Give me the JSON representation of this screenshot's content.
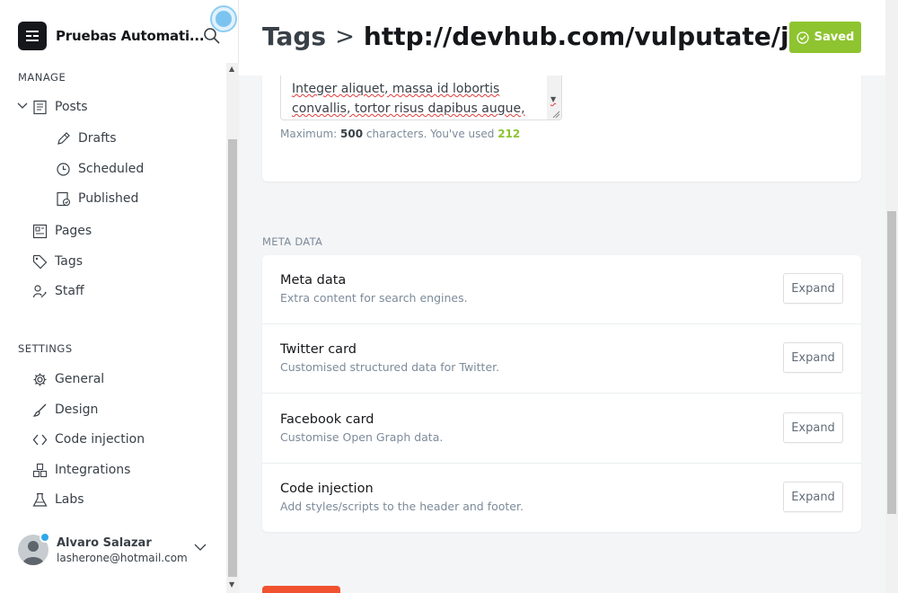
{
  "sidebar": {
    "brand": "Pruebas Automati...",
    "manage_title": "MANAGE",
    "settings_title": "SETTINGS",
    "manage_items": [
      {
        "label": "Posts",
        "icon": "posts-icon"
      },
      {
        "label": "Drafts",
        "icon": "pencil-icon"
      },
      {
        "label": "Scheduled",
        "icon": "clock-icon"
      },
      {
        "label": "Published",
        "icon": "published-icon"
      },
      {
        "label": "Pages",
        "icon": "pages-icon"
      },
      {
        "label": "Tags",
        "icon": "tag-icon"
      },
      {
        "label": "Staff",
        "icon": "staff-icon"
      }
    ],
    "settings_items": [
      {
        "label": "General",
        "icon": "gear-icon"
      },
      {
        "label": "Design",
        "icon": "brush-icon"
      },
      {
        "label": "Code injection",
        "icon": "code-icon"
      },
      {
        "label": "Integrations",
        "icon": "integrations-icon"
      },
      {
        "label": "Labs",
        "icon": "flask-icon"
      }
    ],
    "user": {
      "name": "Alvaro Salazar",
      "email": "lasherone@hotmail.com"
    }
  },
  "header": {
    "crumb_parent": "Tags",
    "crumb_separator": ">",
    "crumb_url": "http://devhub.com/vulputate/justo/in/",
    "saved_label": "Saved"
  },
  "description": {
    "text_line1": "Integer aliquet, massa id lobortis",
    "text_line2": "convallis, tortor risus dapibus augue, vel",
    "hint_prefix": "Maximum:",
    "hint_max": "500",
    "hint_mid": "characters. You've used",
    "hint_used": "212"
  },
  "meta": {
    "section_title": "META DATA",
    "rows": [
      {
        "title": "Meta data",
        "desc": "Extra content for search engines.",
        "button": "Expand"
      },
      {
        "title": "Twitter card",
        "desc": "Customised structured data for Twitter.",
        "button": "Expand"
      },
      {
        "title": "Facebook card",
        "desc": "Customise Open Graph data.",
        "button": "Expand"
      },
      {
        "title": "Code injection",
        "desc": "Add styles/scripts to the header and footer.",
        "button": "Expand"
      }
    ]
  },
  "colors": {
    "accent_green": "#8ec42f",
    "delete_red": "#f05230",
    "badge_blue": "#30a8e8"
  }
}
